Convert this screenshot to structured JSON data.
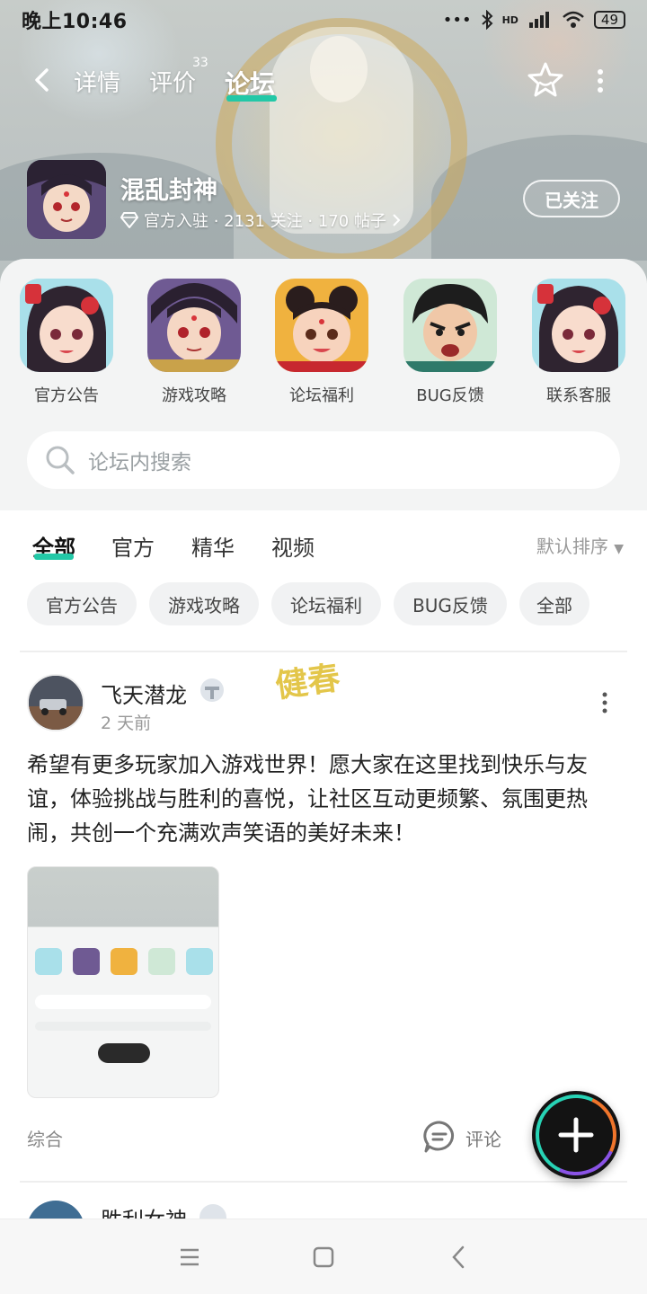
{
  "status_bar": {
    "time": "晚上10:46",
    "network": "HD",
    "battery": "49"
  },
  "nav": {
    "tabs": [
      {
        "label": "详情",
        "active": false
      },
      {
        "label": "评价",
        "active": false,
        "count": "33"
      },
      {
        "label": "论坛",
        "active": true
      }
    ],
    "accent_color": "#23c8a7"
  },
  "game": {
    "name": "混乱封神",
    "meta": "官方入驻 · 2131 关注 · 170 帖子",
    "follow_label": "已关注"
  },
  "shortcuts": [
    {
      "label": "官方公告"
    },
    {
      "label": "游戏攻略"
    },
    {
      "label": "论坛福利"
    },
    {
      "label": "BUG反馈"
    },
    {
      "label": "联系客服"
    }
  ],
  "search": {
    "placeholder": "论坛内搜索"
  },
  "filter_tabs": [
    {
      "label": "全部",
      "active": true
    },
    {
      "label": "官方",
      "active": false
    },
    {
      "label": "精华",
      "active": false
    },
    {
      "label": "视频",
      "active": false
    }
  ],
  "sort_label": "默认排序",
  "chips": [
    "官方公告",
    "游戏攻略",
    "论坛福利",
    "BUG反馈",
    "全部"
  ],
  "post": {
    "user": "飞天潜龙",
    "time": "2 天前",
    "watermark": "健春",
    "text": "希望有更多玩家加入游戏世界！愿大家在这里找到快乐与友谊，体验挑战与胜利的喜悦，让社区互动更频繁、氛围更热闹，共创一个充满欢声笑语的美好未来！",
    "category": "综合",
    "comment_label": "评论"
  },
  "next_post": {
    "user": "胜利女神"
  }
}
